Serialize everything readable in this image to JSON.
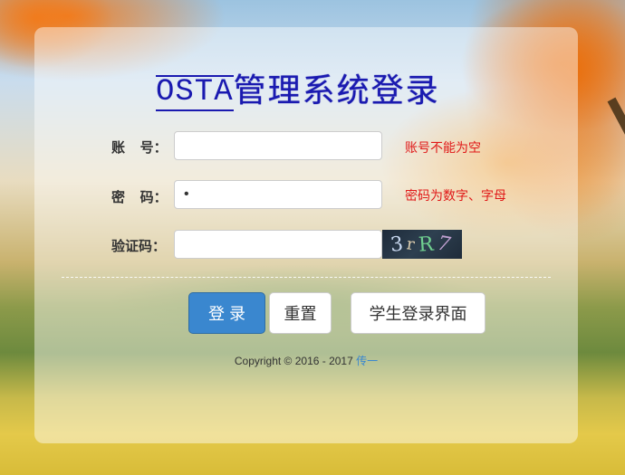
{
  "title": {
    "latin": "OSTA",
    "chinese": "管理系统登录"
  },
  "form": {
    "account": {
      "label": "账    号：",
      "value": "",
      "hint": "账号不能为空"
    },
    "password": {
      "label": "密    码：",
      "value": "•",
      "hint": "密码为数字、字母"
    },
    "captcha": {
      "label": "验证码：",
      "value": "",
      "image_text": "3rR7"
    }
  },
  "buttons": {
    "login": "登 录",
    "reset": "重置",
    "student_login": "学生登录界面"
  },
  "footer": {
    "copyright": "Copyright © 2016 - 2017 ",
    "link": "传一"
  },
  "colors": {
    "primary": "#3a87cf",
    "error": "#e01818",
    "title": "#1a1ab0"
  }
}
